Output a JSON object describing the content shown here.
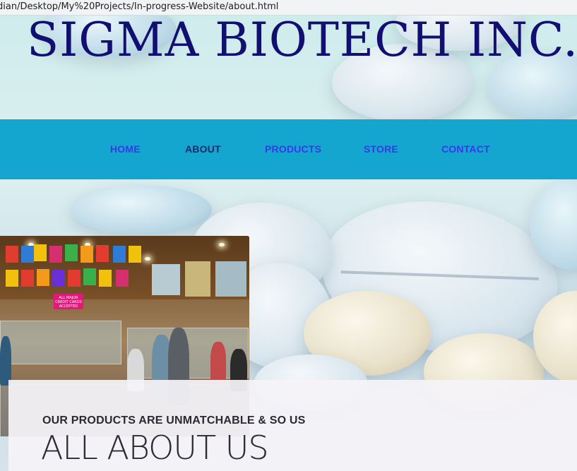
{
  "browser": {
    "address": "dian/Desktop/My%20Projects/In-progress-Website/about.html"
  },
  "site": {
    "logo_text": "SIGMA BIOTECH INC.",
    "brand_color": "#110f72"
  },
  "nav": {
    "background": "#15a6cf",
    "items": [
      {
        "label": "HOME"
      },
      {
        "label": "ABOUT",
        "active": true
      },
      {
        "label": "PRODUCTS"
      },
      {
        "label": "STORE"
      },
      {
        "label": "CONTACT"
      }
    ]
  },
  "photo": {
    "sign_text": "ALL MAJOR CREDIT CARDS ACCEPTED"
  },
  "about": {
    "tagline": "OUR PRODUCTS ARE UNMATCHABLE & SO US",
    "heading": "ALL ABOUT US"
  }
}
